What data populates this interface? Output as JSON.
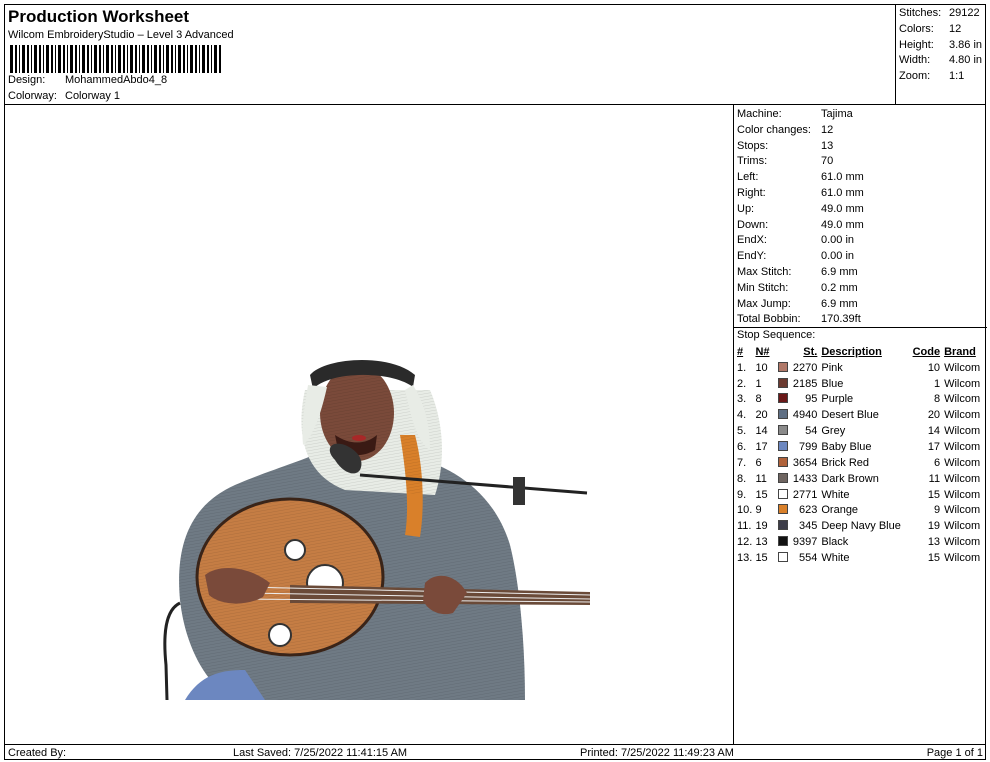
{
  "header": {
    "title": "Production Worksheet",
    "subtitle": "Wilcom EmbroideryStudio – Level 3 Advanced",
    "design_label": "Design:",
    "design_value": "MohammedAbdo4_8",
    "colorway_label": "Colorway:",
    "colorway_value": "Colorway 1"
  },
  "stats": [
    {
      "label": "Stitches:",
      "value": "29122"
    },
    {
      "label": "Colors:",
      "value": "12"
    },
    {
      "label": "Height:",
      "value": "3.86 in"
    },
    {
      "label": "Width:",
      "value": "4.80 in"
    },
    {
      "label": "Zoom:",
      "value": "1:1"
    }
  ],
  "machine_info": [
    {
      "label": "Machine:",
      "value": "Tajima"
    },
    {
      "label": "Color changes:",
      "value": "12"
    },
    {
      "label": "Stops:",
      "value": "13"
    },
    {
      "label": "Trims:",
      "value": "70"
    },
    {
      "label": "Left:",
      "value": "61.0 mm"
    },
    {
      "label": "Right:",
      "value": "61.0 mm"
    },
    {
      "label": "Up:",
      "value": "49.0 mm"
    },
    {
      "label": "Down:",
      "value": "49.0 mm"
    },
    {
      "label": "EndX:",
      "value": "0.00 in"
    },
    {
      "label": "EndY:",
      "value": "0.00 in"
    },
    {
      "label": "Max Stitch:",
      "value": "6.9 mm"
    },
    {
      "label": "Min Stitch:",
      "value": "0.2 mm"
    },
    {
      "label": "Max Jump:",
      "value": "6.9 mm"
    },
    {
      "label": "Total Bobbin:",
      "value": "170.39ft"
    }
  ],
  "stop_sequence": {
    "title": "Stop Sequence:",
    "headers": {
      "idx": "#",
      "n": "N#",
      "st": "St.",
      "desc": "Description",
      "code": "Code",
      "brand": "Brand"
    },
    "rows": [
      {
        "idx": "1.",
        "n": "10",
        "color": "#b07868",
        "st": "2270",
        "desc": "Pink",
        "code": "10",
        "brand": "Wilcom"
      },
      {
        "idx": "2.",
        "n": "1",
        "color": "#6b3a30",
        "st": "2185",
        "desc": "Blue",
        "code": "1",
        "brand": "Wilcom"
      },
      {
        "idx": "3.",
        "n": "8",
        "color": "#6a1818",
        "st": "95",
        "desc": "Purple",
        "code": "8",
        "brand": "Wilcom"
      },
      {
        "idx": "4.",
        "n": "20",
        "color": "#5f6f84",
        "st": "4940",
        "desc": "Desert Blue",
        "code": "20",
        "brand": "Wilcom"
      },
      {
        "idx": "5.",
        "n": "14",
        "color": "#8a8a8a",
        "st": "54",
        "desc": "Grey",
        "code": "14",
        "brand": "Wilcom"
      },
      {
        "idx": "6.",
        "n": "17",
        "color": "#6c87c0",
        "st": "799",
        "desc": "Baby Blue",
        "code": "17",
        "brand": "Wilcom"
      },
      {
        "idx": "7.",
        "n": "6",
        "color": "#b0623a",
        "st": "3654",
        "desc": "Brick Red",
        "code": "6",
        "brand": "Wilcom"
      },
      {
        "idx": "8.",
        "n": "11",
        "color": "#6e6460",
        "st": "1433",
        "desc": "Dark Brown",
        "code": "11",
        "brand": "Wilcom"
      },
      {
        "idx": "9.",
        "n": "15",
        "color": "#ffffff",
        "st": "2771",
        "desc": "White",
        "code": "15",
        "brand": "Wilcom"
      },
      {
        "idx": "10.",
        "n": "9",
        "color": "#d9802a",
        "st": "623",
        "desc": "Orange",
        "code": "9",
        "brand": "Wilcom"
      },
      {
        "idx": "11.",
        "n": "19",
        "color": "#3c3c48",
        "st": "345",
        "desc": "Deep Navy Blue",
        "code": "19",
        "brand": "Wilcom"
      },
      {
        "idx": "12.",
        "n": "13",
        "color": "#111111",
        "st": "9397",
        "desc": "Black",
        "code": "13",
        "brand": "Wilcom"
      },
      {
        "idx": "13.",
        "n": "15",
        "color": "#ffffff",
        "st": "554",
        "desc": "White",
        "code": "15",
        "brand": "Wilcom"
      }
    ]
  },
  "footer": {
    "created_by": "Created By:",
    "last_saved": "Last Saved: 7/25/2022 11:41:15 AM",
    "printed": "Printed: 7/25/2022 11:49:23 AM",
    "page": "Page 1 of 1"
  }
}
